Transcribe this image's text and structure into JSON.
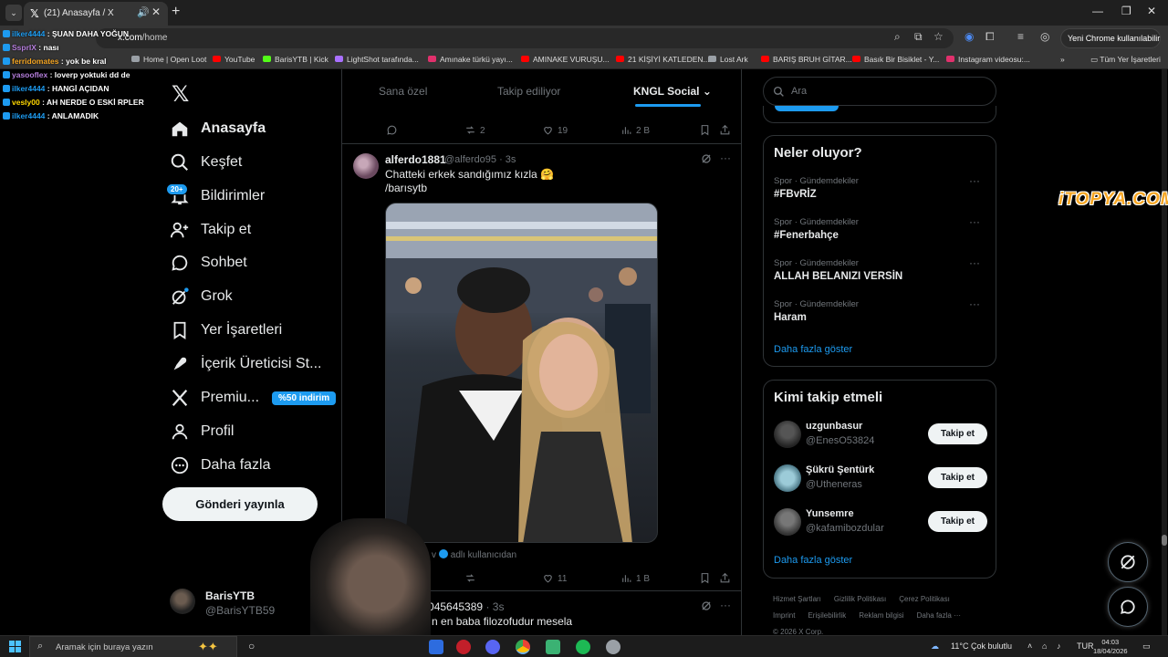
{
  "browser": {
    "tab_title": "(21) Anasayfa / X",
    "url_host": "x.com",
    "url_path": "/home",
    "profile_label": "Yeni Chrome kullanılabilir",
    "bookmarks": [
      {
        "label": "Home | Open Loot",
        "color": "#9aa0a6"
      },
      {
        "label": "YouTube",
        "color": "#ff0000"
      },
      {
        "label": "BarisYTB | Kick",
        "color": "#53fc18"
      },
      {
        "label": "LightShot tarafında...",
        "color": "#a970ff"
      },
      {
        "label": "Amınake türkü yayı...",
        "color": "#e1306c"
      },
      {
        "label": "AMINAKE VURUŞU...",
        "color": "#ff0000"
      },
      {
        "label": "21 KİŞİYİ KATLEDEN...",
        "color": "#ff0000"
      },
      {
        "label": "Lost Ark",
        "color": "#9aa0a6"
      },
      {
        "label": "BARIŞ BRUH GİTAR...",
        "color": "#ff0000"
      },
      {
        "label": "Basık Bir Bisiklet - Y...",
        "color": "#ff0000"
      },
      {
        "label": "Instagram videosu:...",
        "color": "#e1306c"
      }
    ],
    "all_bookmarks": "Tüm Yer İşaretleri"
  },
  "chat": [
    {
      "user": "ilker4444",
      "message": "ŞUAN DAHA YOĞUN",
      "color": "#1d9bf0"
    },
    {
      "user": "SsprIX",
      "message": "nası",
      "color": "#b57edc"
    },
    {
      "user": "ferridomates",
      "message": "yok be kral",
      "color": "#f6a623"
    },
    {
      "user": "yasooflex",
      "message": "loverp yoktuki dd de",
      "color": "#b57edc"
    },
    {
      "user": "ilker4444",
      "message": "HANGİ AÇIDAN",
      "color": "#1d9bf0"
    },
    {
      "user": "vesly00",
      "message": "AH NERDE O ESKİ RPLER",
      "color": "#ffd700"
    },
    {
      "user": "ilker4444",
      "message": "ANLAMADIK",
      "color": "#1d9bf0"
    }
  ],
  "nav": {
    "notifications_badge": "20+",
    "items": [
      {
        "label": "Anasayfa"
      },
      {
        "label": "Keşfet"
      },
      {
        "label": "Bildirimler"
      },
      {
        "label": "Takip et"
      },
      {
        "label": "Sohbet"
      },
      {
        "label": "Grok"
      },
      {
        "label": "Yer İşaretleri"
      },
      {
        "label": "İçerik Üreticisi St..."
      },
      {
        "label": "Premiu..."
      },
      {
        "label": "Profil"
      },
      {
        "label": "Daha fazla"
      }
    ],
    "premium_badge": "%50 indirim",
    "post_button": "Gönderi yayınla",
    "account": {
      "name": "BarisYTB",
      "handle": "@BarisYTB59"
    }
  },
  "feed": {
    "tabs": [
      "Sana özel",
      "Takip ediliyor",
      "KNGL Social"
    ],
    "previous_actions": {
      "retweets": "2",
      "likes": "19",
      "views": "2 B"
    },
    "tweet": {
      "name": "alferdo1881",
      "handle_time": "@alferdo95 · 3s",
      "text_line1": "Chatteki erkek sandığımız kızla 🤗",
      "text_line2": "/barısytb",
      "media_caption_prefix": "v",
      "media_caption": "adlı kullanıcıdan",
      "actions": {
        "likes": "11",
        "views": "1 B"
      }
    },
    "next_tweet": {
      "name": "hur3045645389",
      "time": "· 3s",
      "text": "üzyılın en baba filozofudur mesela"
    }
  },
  "right": {
    "search_placeholder": "Ara",
    "trends_title": "Neler oluyor?",
    "trends": [
      {
        "category": "Spor · Gündemdekiler",
        "name": "#FBvRİZ"
      },
      {
        "category": "Spor · Gündemdekiler",
        "name": "#Fenerbahçe"
      },
      {
        "category": "Spor · Gündemdekiler",
        "name": "ALLAH BELANIZI VERSİN"
      },
      {
        "category": "Spor · Gündemdekiler",
        "name": "Haram"
      }
    ],
    "show_more": "Daha fazla göster",
    "who_title": "Kimi takip etmeli",
    "who": [
      {
        "name": "uzgunbasur",
        "handle": "@EnesO53824",
        "button": "Takip et"
      },
      {
        "name": "Şükrü Şentürk",
        "handle": "@Utheneras",
        "button": "Takip et"
      },
      {
        "name": "Yunsemre",
        "handle": "@kafamibozdular",
        "button": "Takip et"
      }
    ],
    "footer": [
      "Hizmet Şartları",
      "Gizlilik Politikası",
      "Çerez Politikası",
      "Imprint",
      "Erişilebilirlik",
      "Reklam bilgisi",
      "Daha fazla ···",
      "© 2026 X Corp."
    ]
  },
  "watermark": "iTOPYA.COM",
  "taskbar": {
    "search_placeholder": "Aramak için buraya yazın",
    "weather": "11°C  Çok bulutlu",
    "lang": "TUR",
    "time": "04:03",
    "date": "18/04/2026"
  }
}
